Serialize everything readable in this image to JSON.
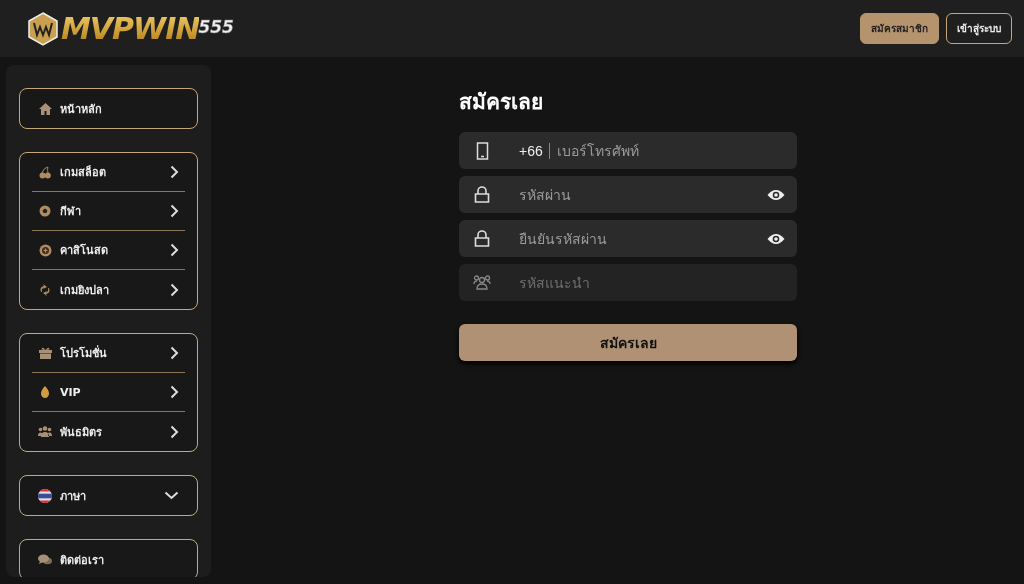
{
  "header": {
    "logo": {
      "name": "MVPWIN",
      "suffix": "555"
    },
    "buttons": [
      {
        "label": "สมัครสมาชิก",
        "kind": "primary"
      },
      {
        "label": "เข้าสู่ระบบ",
        "kind": "outline"
      }
    ]
  },
  "sidebar": {
    "groups": [
      {
        "items": [
          {
            "label": "หน้าหลัก",
            "kind": "link"
          }
        ]
      },
      {
        "items": [
          {
            "label": "เกมสล็อต",
            "kind": "submenu"
          },
          {
            "label": "กีฬา",
            "kind": "submenu"
          },
          {
            "label": "คาสิโนสด",
            "kind": "submenu"
          },
          {
            "label": "เกมยิงปลา",
            "kind": "submenu"
          }
        ]
      },
      {
        "items": [
          {
            "label": "โปรโมชั่น",
            "kind": "submenu"
          },
          {
            "label": "VIP",
            "kind": "submenu"
          },
          {
            "label": "พันธมิตร",
            "kind": "submenu"
          }
        ]
      },
      {
        "items": [
          {
            "label": "ภาษา",
            "kind": "dropdown"
          }
        ]
      },
      {
        "items": [
          {
            "label": "ติดต่อเรา",
            "kind": "link"
          }
        ]
      }
    ]
  },
  "form": {
    "title": "สมัครเลย",
    "fields": [
      {
        "kind": "phone",
        "prefix": "+66",
        "placeholder": "เบอร์โทรศัพท์"
      },
      {
        "kind": "password",
        "placeholder": "รหัสผ่าน"
      },
      {
        "kind": "password",
        "placeholder": "ยืนยันรหัสผ่าน"
      },
      {
        "kind": "referral",
        "placeholder": "รหัสแนะนำ"
      }
    ],
    "submit": "สมัครเลย"
  }
}
